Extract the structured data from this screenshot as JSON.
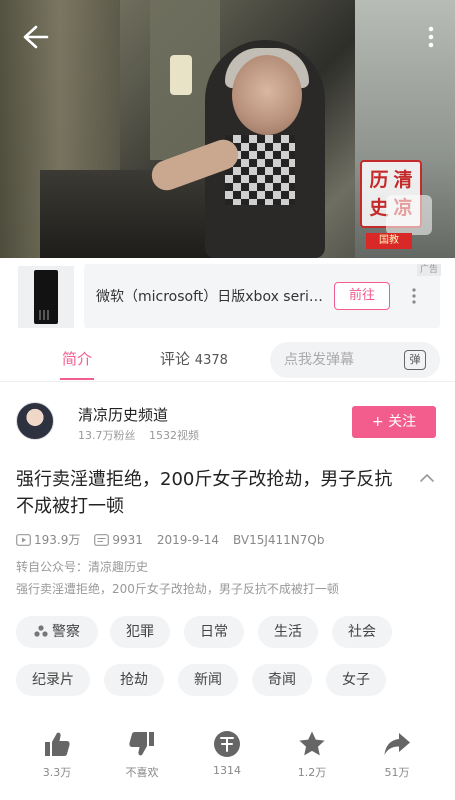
{
  "ad": {
    "title": "微软（microsoft）日版xbox seri…",
    "go_label": "前往",
    "tag": "广告"
  },
  "video": {
    "watermark_chars": [
      "历",
      "清",
      "史",
      "凉"
    ],
    "watermark_sub": "国教"
  },
  "tabs": {
    "intro": "简介",
    "comments_label": "评论",
    "comments_count": "4378",
    "danmu_placeholder": "点我发弹幕",
    "danmu_icon_text": "弹"
  },
  "uploader": {
    "name": "清凉历史频道",
    "fans": "13.7万粉丝",
    "videos": "1532视频",
    "follow_label": "+ 关注"
  },
  "info": {
    "title": "强行卖淫遭拒绝，200斤女子改抢劫，男子反抗不成被打一顿",
    "views": "193.9万",
    "danmaku": "9931",
    "date": "2019-9-14",
    "bvid": "BV15J411N7Qb",
    "repost": "转自公众号：清凉趣历史",
    "description": "强行卖淫遭拒绝，200斤女子改抢劫，男子反抗不成被打一顿"
  },
  "tags": [
    "警察",
    "犯罪",
    "日常",
    "生活",
    "社会",
    "纪录片",
    "抢劫",
    "新闻",
    "奇闻",
    "女子"
  ],
  "actions": {
    "like": "3.3万",
    "dislike": "不喜欢",
    "coin": "1314",
    "favorite": "1.2万",
    "share": "51万"
  },
  "colors": {
    "accent": "#f25d8e"
  }
}
